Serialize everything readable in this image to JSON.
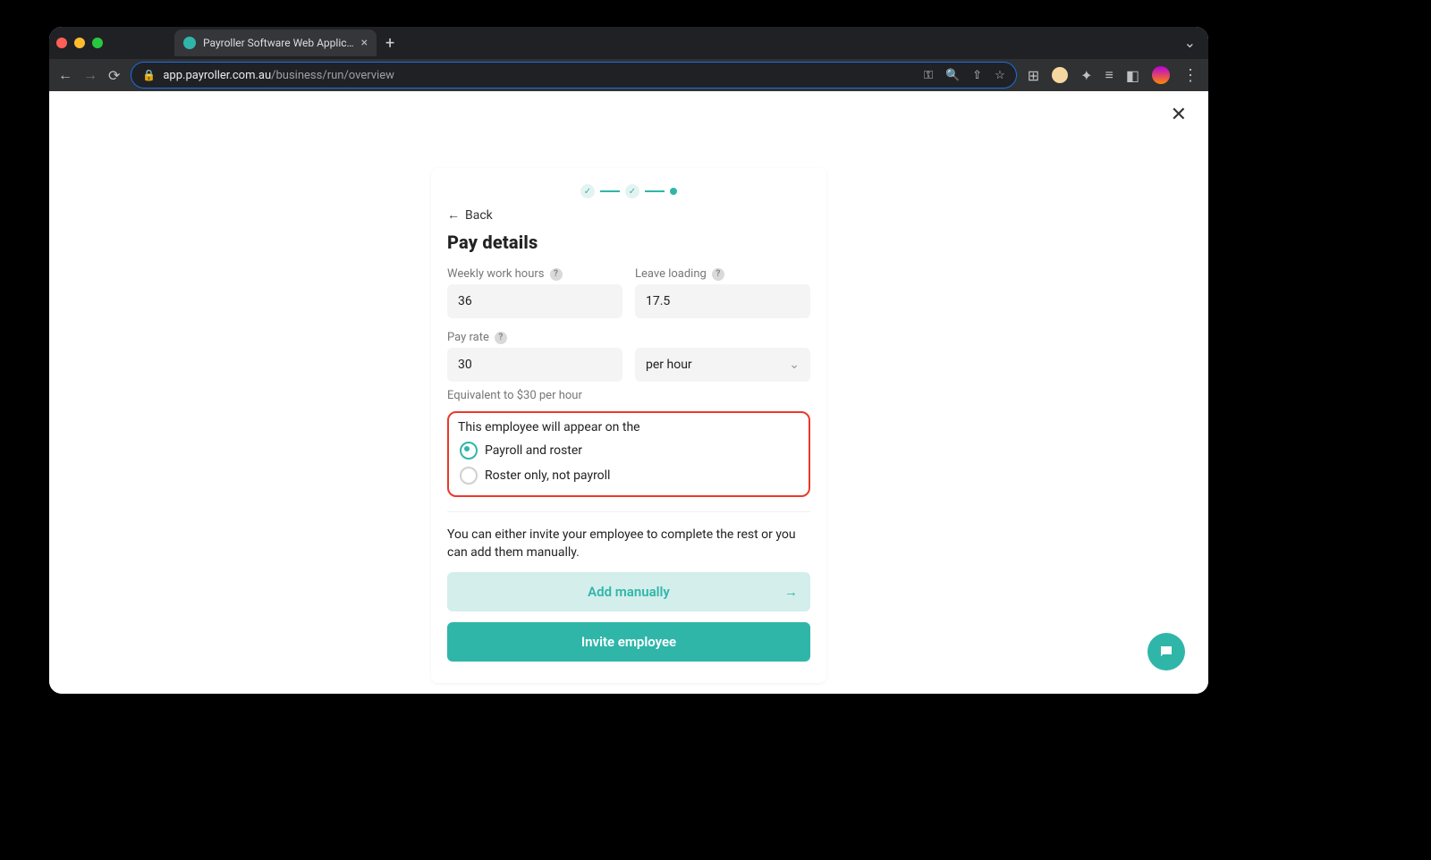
{
  "browser": {
    "tab_title": "Payroller Software Web Applic…",
    "url_host": "app.payroller.com.au",
    "url_path": "/business/run/overview"
  },
  "page": {
    "back_label": "Back",
    "title": "Pay details",
    "close_alt": "Close"
  },
  "fields": {
    "weekly_hours_label": "Weekly work hours",
    "weekly_hours_value": "36",
    "leave_loading_label": "Leave loading",
    "leave_loading_value": "17.5",
    "pay_rate_label": "Pay rate",
    "pay_rate_value": "30",
    "pay_rate_unit": "per hour",
    "equivalent_hint": "Equivalent to $30 per hour"
  },
  "appears_on": {
    "title": "This employee will appear on the",
    "option_payroll_roster": "Payroll and roster",
    "option_roster_only": "Roster only, not payroll",
    "selected": "payroll_roster"
  },
  "footer": {
    "info": "You can either invite your employee to complete the rest or you can add them manually.",
    "add_manually_label": "Add manually",
    "invite_label": "Invite employee"
  }
}
